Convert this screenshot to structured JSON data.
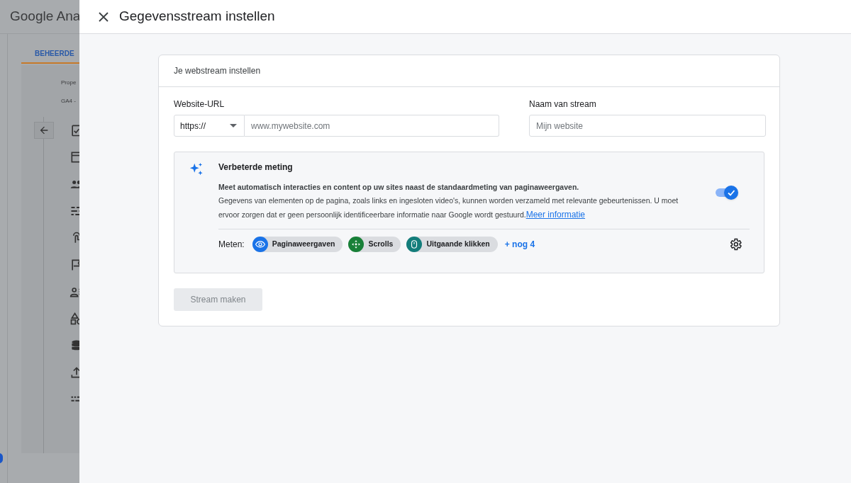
{
  "background": {
    "app_title": "Google Ana",
    "tab": "BEHEERDE",
    "property_label": "Prope",
    "property_value": "GA4 -"
  },
  "dialog": {
    "title": "Gegevensstream instellen"
  },
  "card": {
    "heading": "Je webstream instellen",
    "url_label": "Website-URL",
    "protocol": "https://",
    "url_placeholder": "www.mywebsite.com",
    "name_label": "Naam van stream",
    "name_placeholder": "Mijn website",
    "enhanced": {
      "title": "Verbeterde meting",
      "summary": "Meet automatisch interacties en content op uw sites naast de standaardmeting van paginaweergaven.",
      "details": "Gegevens van elementen op de pagina, zoals links en ingesloten video's, kunnen worden verzameld met relevante gebeurtenissen. U moet ervoor zorgen dat er geen persoonlijk identificeerbare informatie naar Google wordt gestuurd.",
      "link": "Meer informatie",
      "on": true,
      "measure_label": "Meten:",
      "chips": [
        {
          "kind": "eye",
          "label": "Paginaweergaven",
          "color": "#1a73e8"
        },
        {
          "kind": "scroll",
          "label": "Scrolls",
          "color": "#188038"
        },
        {
          "kind": "mouse",
          "label": "Uitgaande klikken",
          "color": "#137d7b"
        }
      ],
      "more": "+ nog 4"
    },
    "button": {
      "label": "Stream maken",
      "disabled": true
    }
  }
}
